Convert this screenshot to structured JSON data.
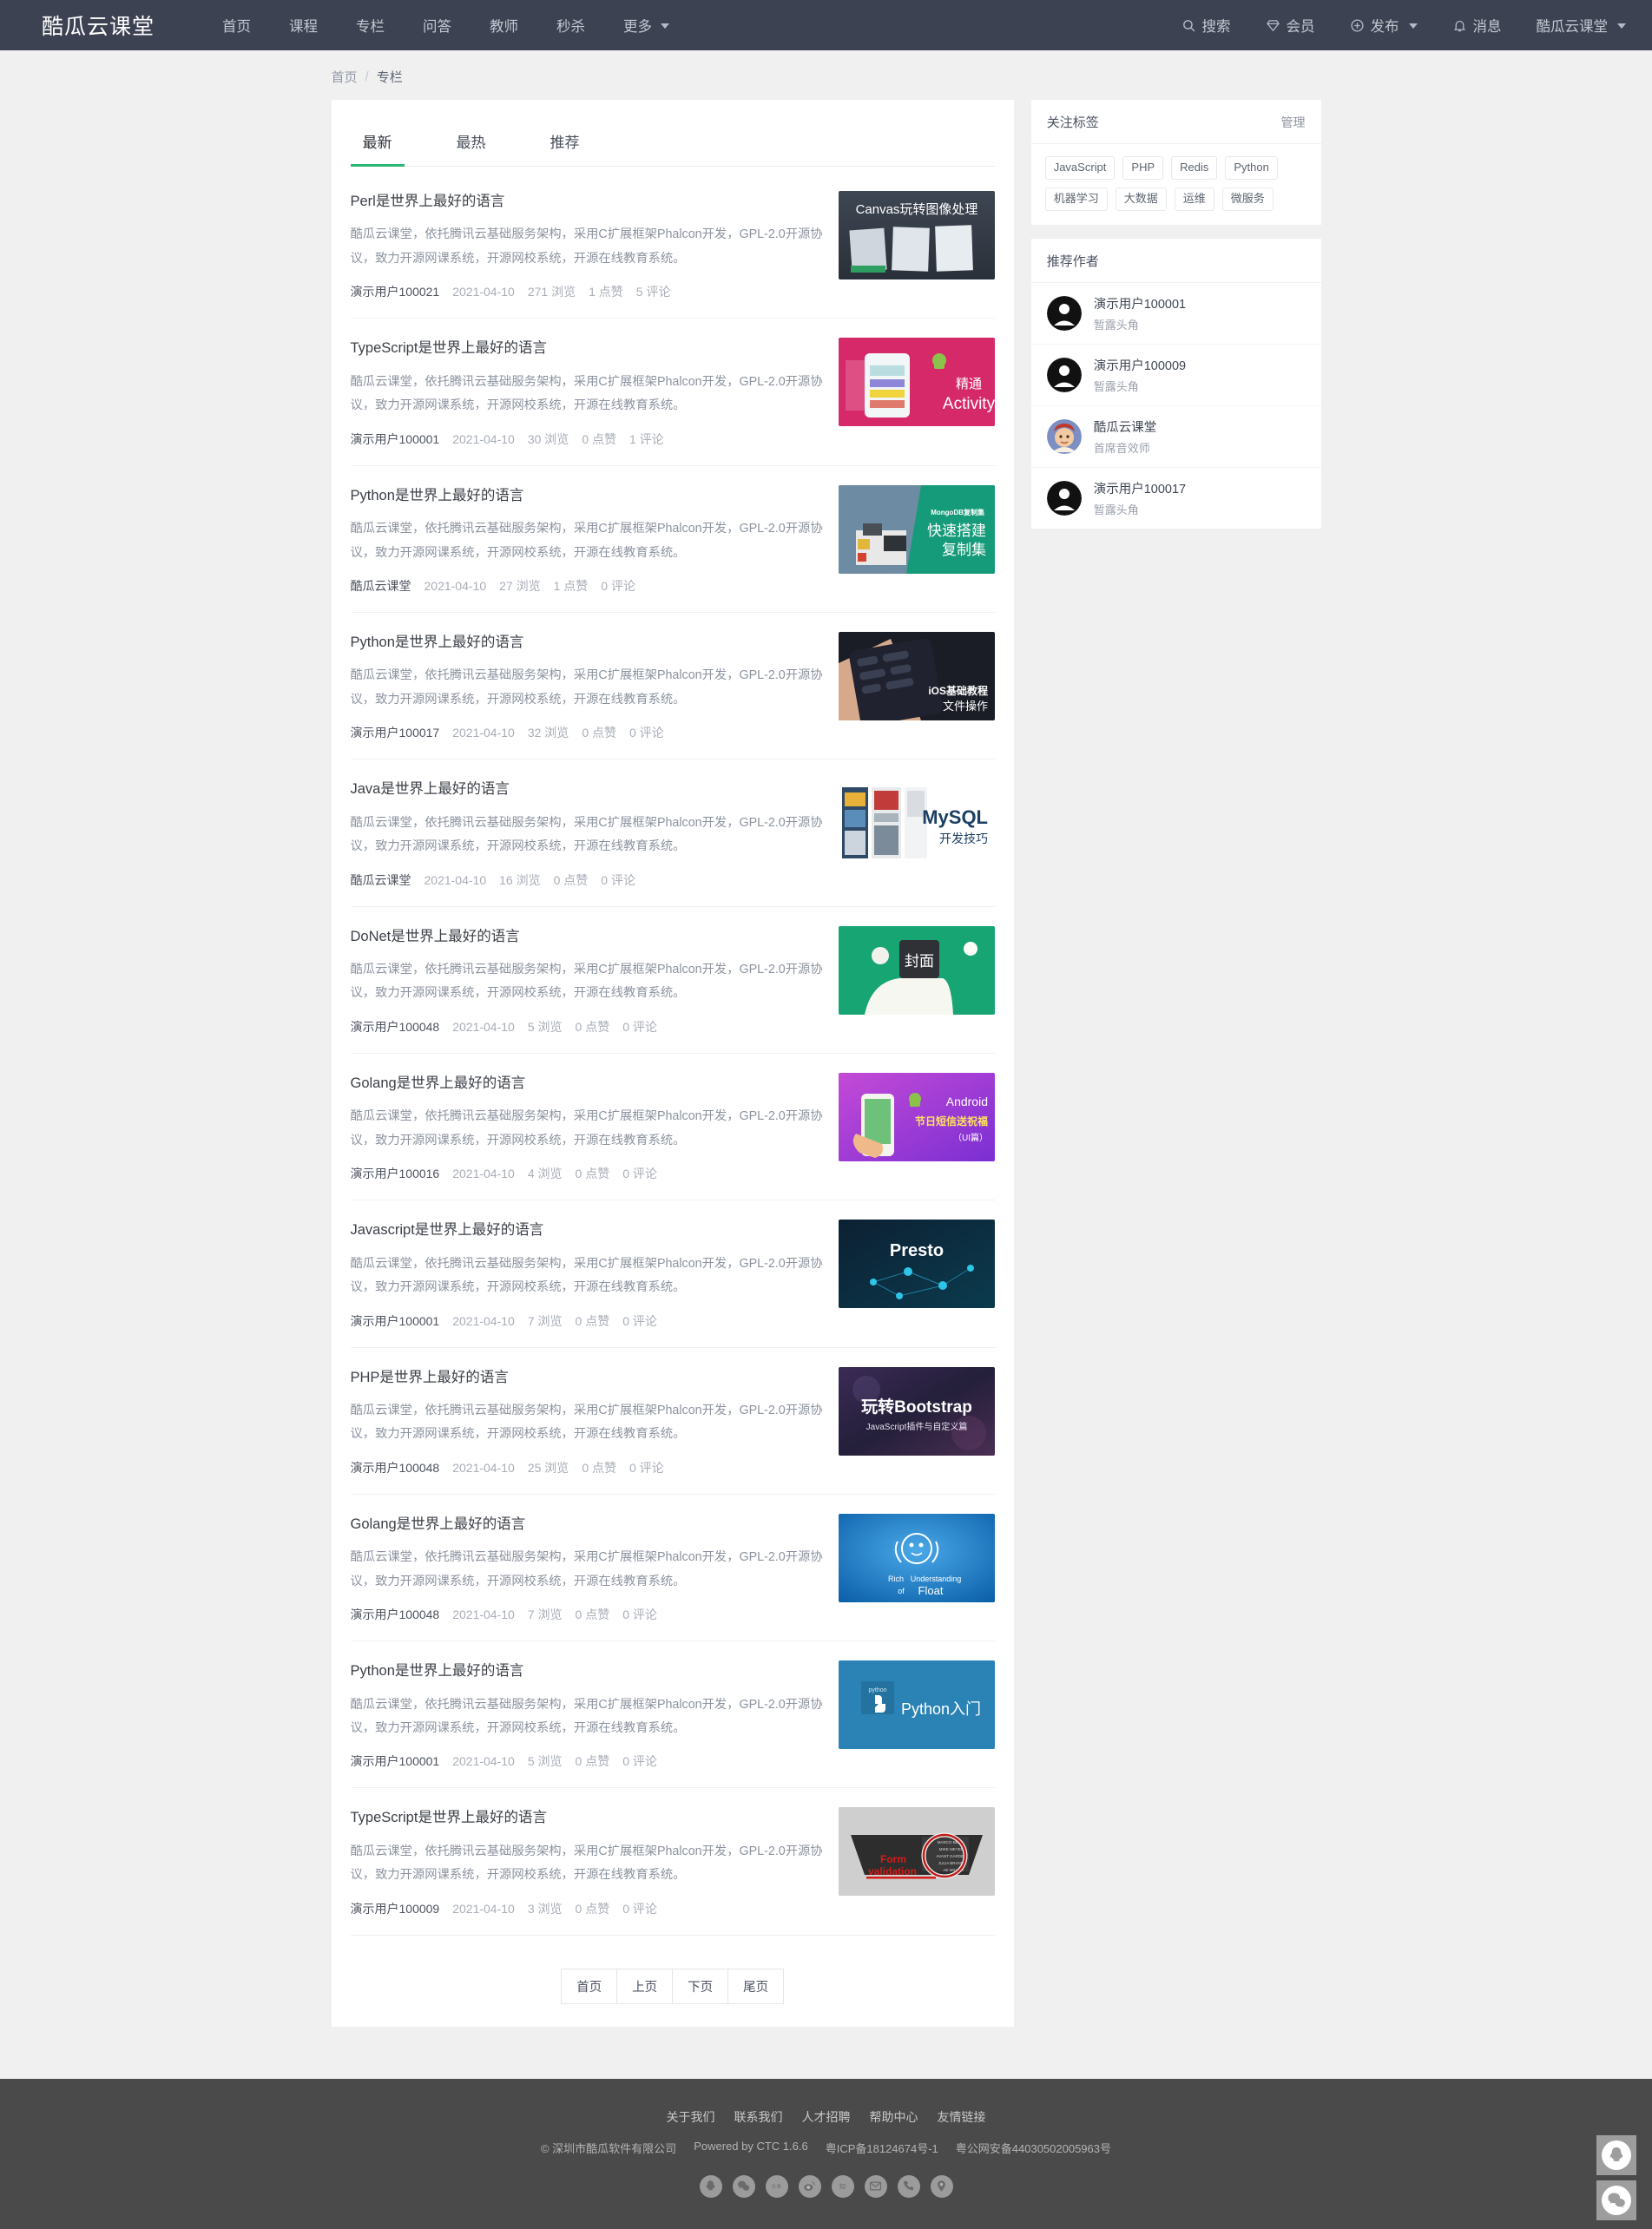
{
  "navbar": {
    "brand": "酷瓜云课堂",
    "links": [
      {
        "label": "首页",
        "icon": ""
      },
      {
        "label": "课程",
        "icon": ""
      },
      {
        "label": "专栏",
        "icon": ""
      },
      {
        "label": "问答",
        "icon": ""
      },
      {
        "label": "教师",
        "icon": ""
      },
      {
        "label": "秒杀",
        "icon": ""
      },
      {
        "label": "更多",
        "icon": "chevron-down-icon"
      }
    ],
    "right": [
      {
        "label": "搜索",
        "icon": "search-icon"
      },
      {
        "label": "会员",
        "icon": "diamond-icon"
      },
      {
        "label": "发布",
        "icon": "plus-circle-icon",
        "caret": true
      },
      {
        "label": "消息",
        "icon": "bell-icon"
      },
      {
        "label": "酷瓜云课堂",
        "icon": "",
        "caret": true
      }
    ]
  },
  "breadcrumb": {
    "home": "首页",
    "sep": "/",
    "current": "专栏"
  },
  "tabs": [
    {
      "label": "最新",
      "active": true
    },
    {
      "label": "最热",
      "active": false
    },
    {
      "label": "推荐",
      "active": false
    }
  ],
  "accent_color": "#2bb673",
  "article_desc": "酷瓜云课堂，依托腾讯云基础服务架构，采用C扩展框架Phalcon开发，GPL-2.0开源协议，致力开源网课系统，开源网校系统，开源在线教育系统。",
  "articles": [
    {
      "title": "Perl是世界上最好的语言",
      "author": "演示用户100021",
      "date": "2021-04-10",
      "views": "271 浏览",
      "likes": "1 点赞",
      "comments": "5 评论",
      "thumb": "canvas-image-processing"
    },
    {
      "title": "TypeScript是世界上最好的语言",
      "author": "演示用户100001",
      "date": "2021-04-10",
      "views": "30 浏览",
      "likes": "0 点赞",
      "comments": "1 评论",
      "thumb": "android-activity"
    },
    {
      "title": "Python是世界上最好的语言",
      "author": "酷瓜云课堂",
      "date": "2021-04-10",
      "views": "27 浏览",
      "likes": "1 点赞",
      "comments": "0 评论",
      "thumb": "mongodb-replica"
    },
    {
      "title": "Python是世界上最好的语言",
      "author": "演示用户100017",
      "date": "2021-04-10",
      "views": "32 浏览",
      "likes": "0 点赞",
      "comments": "0 评论",
      "thumb": "ios-tutorial"
    },
    {
      "title": "Java是世界上最好的语言",
      "author": "酷瓜云课堂",
      "date": "2021-04-10",
      "views": "16 浏览",
      "likes": "0 点赞",
      "comments": "0 评论",
      "thumb": "mysql-tips"
    },
    {
      "title": "DoNet是世界上最好的语言",
      "author": "演示用户100048",
      "date": "2021-04-10",
      "views": "5 浏览",
      "likes": "0 点赞",
      "comments": "0 评论",
      "thumb": "green-hand"
    },
    {
      "title": "Golang是世界上最好的语言",
      "author": "演示用户100016",
      "date": "2021-04-10",
      "views": "4 浏览",
      "likes": "0 点赞",
      "comments": "0 评论",
      "thumb": "android-holiday"
    },
    {
      "title": "Javascript是世界上最好的语言",
      "author": "演示用户100001",
      "date": "2021-04-10",
      "views": "7 浏览",
      "likes": "0 点赞",
      "comments": "0 评论",
      "thumb": "presto"
    },
    {
      "title": "PHP是世界上最好的语言",
      "author": "演示用户100048",
      "date": "2021-04-10",
      "views": "25 浏览",
      "likes": "0 点赞",
      "comments": "0 评论",
      "thumb": "bootstrap"
    },
    {
      "title": "Golang是世界上最好的语言",
      "author": "演示用户100048",
      "date": "2021-04-10",
      "views": "7 浏览",
      "likes": "0 点赞",
      "comments": "0 评论",
      "thumb": "float-understanding"
    },
    {
      "title": "Python是世界上最好的语言",
      "author": "演示用户100001",
      "date": "2021-04-10",
      "views": "5 浏览",
      "likes": "0 点赞",
      "comments": "0 评论",
      "thumb": "python-intro"
    },
    {
      "title": "TypeScript是世界上最好的语言",
      "author": "演示用户100009",
      "date": "2021-04-10",
      "views": "3 浏览",
      "likes": "0 点赞",
      "comments": "0 评论",
      "thumb": "form-validation"
    }
  ],
  "thumb_text": {
    "canvas-image-processing": "Canvas玩转图像处理",
    "android-activity_1": "精通",
    "android-activity_2": "Activity",
    "mongodb-replica_1": "MongoDB复制集",
    "mongodb-replica_2": "快速搭建",
    "mongodb-replica_3": "复制集",
    "ios-tutorial_1": "iOS基础教程",
    "ios-tutorial_2": "文件操作",
    "mysql-tips_1": "MySQL",
    "mysql-tips_2": "开发技巧",
    "android-holiday_1": "Android",
    "android-holiday_2": "节日短信送祝福",
    "android-holiday_3": "（UI篇）",
    "presto": "Presto",
    "bootstrap_1": "玩转Bootstrap",
    "bootstrap_2": "JavaScript插件与自定义篇",
    "float-understanding_1": "Rich",
    "float-understanding_2": "Understanding",
    "float-understanding_3": "of",
    "float-understanding_4": "Float",
    "python-intro_1": "python",
    "python-intro_2": "Python入门",
    "form-validation_1": "Form",
    "form-validation_2": "validation"
  },
  "pagination": [
    {
      "label": "首页"
    },
    {
      "label": "上页"
    },
    {
      "label": "下页"
    },
    {
      "label": "尾页"
    }
  ],
  "sidebar": {
    "tags_card": {
      "title": "关注标签",
      "manage": "管理",
      "tags": [
        "JavaScript",
        "PHP",
        "Redis",
        "Python",
        "机器学习",
        "大数据",
        "运维",
        "微服务"
      ]
    },
    "authors_card": {
      "title": "推荐作者",
      "authors": [
        {
          "name": "演示用户100001",
          "role": "暂露头角",
          "avatar": "default-avatar"
        },
        {
          "name": "演示用户100009",
          "role": "暂露头角",
          "avatar": "default-avatar"
        },
        {
          "name": "酷瓜云课堂",
          "role": "首席音效师",
          "avatar": "photo-avatar"
        },
        {
          "name": "演示用户100017",
          "role": "暂露头角",
          "avatar": "default-avatar"
        }
      ]
    }
  },
  "footer": {
    "links": [
      "关于我们",
      "联系我们",
      "人才招聘",
      "帮助中心",
      "友情链接"
    ],
    "copyright": "© 深圳市酷瓜软件有限公司",
    "powered": "Powered by CTC 1.6.6",
    "icp": "粤ICP备18124674号-1",
    "police": "粤公网安备44030502005963号",
    "socials": [
      "qq-icon",
      "wechat-icon",
      "toutiao-icon",
      "weibo-icon",
      "zhihu-icon",
      "email-icon",
      "phone-icon",
      "location-icon"
    ]
  },
  "float_buttons": [
    "qq-icon",
    "wechat-icon"
  ]
}
